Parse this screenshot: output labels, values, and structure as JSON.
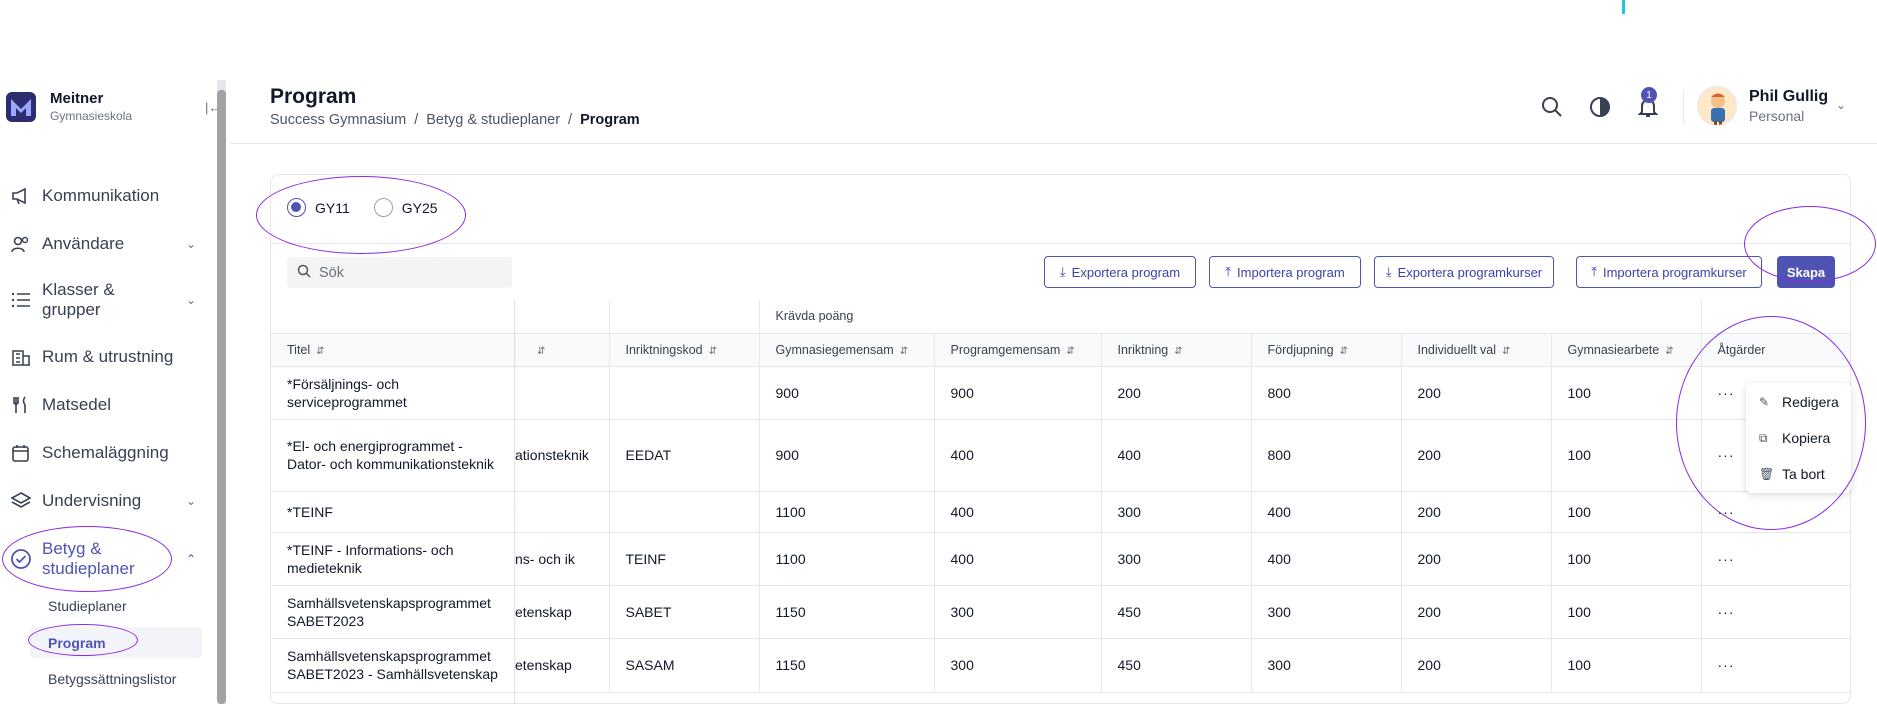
{
  "app": {
    "name": "Meitner",
    "subtitle": "Gymnasieskola"
  },
  "sidebar": {
    "items": [
      {
        "label": "Kommunikation",
        "icon": "megaphone-icon"
      },
      {
        "label": "Användare",
        "icon": "users-icon"
      },
      {
        "label": "Klasser & grupper",
        "icon": "list-icon"
      },
      {
        "label": "Rum & utrustning",
        "icon": "building-icon"
      },
      {
        "label": "Matsedel",
        "icon": "fork-knife-icon"
      },
      {
        "label": "Schemaläggning",
        "icon": "calendar-icon"
      },
      {
        "label": "Undervisning",
        "icon": "layers-icon"
      },
      {
        "label": "Betyg & studieplaner",
        "icon": "check-badge-icon"
      }
    ],
    "subitems": [
      {
        "label": "Studieplaner"
      },
      {
        "label": "Program"
      },
      {
        "label": "Betygssättningslistor"
      }
    ]
  },
  "header": {
    "title": "Program",
    "breadcrumb": [
      "Success Gymnasium",
      "/",
      "Betyg & studieplaner",
      "/",
      "Program"
    ],
    "notification_count": "1",
    "user": {
      "name": "Phil Gullig",
      "role": "Personal"
    }
  },
  "filters": {
    "radios": [
      {
        "label": "GY11",
        "selected": true
      },
      {
        "label": "GY25",
        "selected": false
      }
    ],
    "search_placeholder": "Sök"
  },
  "toolbar": {
    "export_program": "Exportera program",
    "import_program": "Importera program",
    "export_courses": "Exportera programkurser",
    "import_courses": "Importera programkurser",
    "create": "Skapa"
  },
  "table": {
    "group_header": "Krävda poäng",
    "columns": [
      "Titel",
      "",
      "Inriktningskod",
      "Gymnasiegemensam",
      "Programgemensam",
      "Inriktning",
      "Fördjupning",
      "Individuellt val",
      "Gymnasiearbete",
      "Åtgärder"
    ],
    "rows": [
      {
        "title": "*Försäljnings- och serviceprogrammet",
        "hidden": "",
        "code": "",
        "gym": "900",
        "prog": "900",
        "inr": "200",
        "ford": "800",
        "ind": "200",
        "arb": "100"
      },
      {
        "title": "*El- och energiprogrammet - Dator- och kommunikationsteknik",
        "hidden": "ationsteknik",
        "code": "EEDAT",
        "gym": "900",
        "prog": "400",
        "inr": "400",
        "ford": "800",
        "ind": "200",
        "arb": "100"
      },
      {
        "title": "*TEINF",
        "hidden": "",
        "code": "",
        "gym": "1100",
        "prog": "400",
        "inr": "300",
        "ford": "400",
        "ind": "200",
        "arb": "100"
      },
      {
        "title": "*TEINF - Informations- och medieteknik",
        "hidden": "ns- och ik",
        "code": "TEINF",
        "gym": "1100",
        "prog": "400",
        "inr": "300",
        "ford": "400",
        "ind": "200",
        "arb": "100"
      },
      {
        "title": "Samhällsvetenskapsprogrammet SABET2023",
        "hidden": "etenskap",
        "code": "SABET",
        "gym": "1150",
        "prog": "300",
        "inr": "450",
        "ford": "300",
        "ind": "200",
        "arb": "100"
      },
      {
        "title": "Samhällsvetenskapsprogrammet SABET2023 - Samhällsvetenskap",
        "hidden": "etenskap",
        "code": "SASAM",
        "gym": "1150",
        "prog": "300",
        "inr": "450",
        "ford": "300",
        "ind": "200",
        "arb": "100"
      }
    ],
    "actions_label": "···"
  },
  "context_menu": {
    "items": [
      {
        "label": "Redigera",
        "icon": "pencil-icon"
      },
      {
        "label": "Kopiera",
        "icon": "copy-icon"
      },
      {
        "label": "Ta bort",
        "icon": "trash-icon"
      }
    ]
  },
  "colors": {
    "accent": "#4f54b3",
    "annotation": "#8a2be2"
  }
}
